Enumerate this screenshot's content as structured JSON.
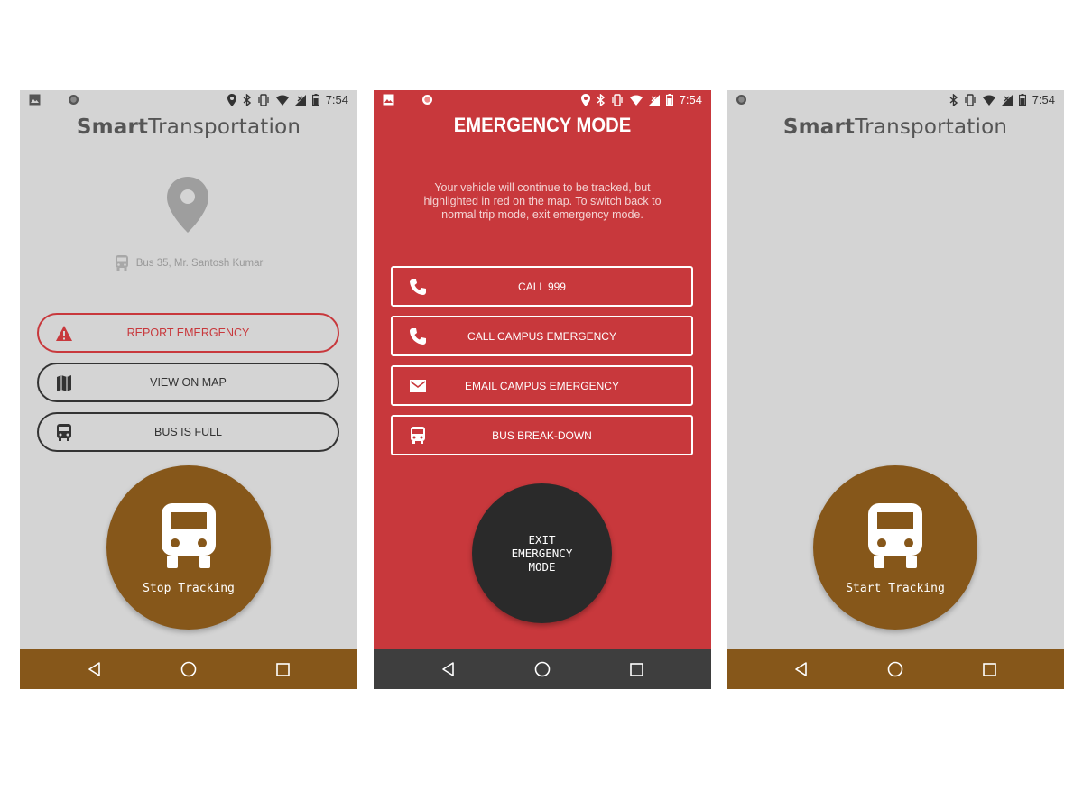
{
  "status_bar": {
    "time": "7:54"
  },
  "screen1": {
    "app_title_bold": "Smart",
    "app_title_rest": "Transportation",
    "bus_info": "Bus 35, Mr. Santosh Kumar",
    "buttons": [
      {
        "label": "REPORT EMERGENCY",
        "icon": "warning-icon"
      },
      {
        "label": "VIEW ON MAP",
        "icon": "map-icon"
      },
      {
        "label": "BUS IS FULL",
        "icon": "bus-icon"
      }
    ],
    "circle_label": "Stop Tracking"
  },
  "screen2": {
    "title": "EMERGENCY MODE",
    "description": "Your vehicle will continue to be tracked, but highlighted in red on the map. To switch back to normal trip mode, exit emergency mode.",
    "buttons": [
      {
        "label": "CALL 999",
        "icon": "phone-icon"
      },
      {
        "label": "CALL CAMPUS EMERGENCY",
        "icon": "phone-icon"
      },
      {
        "label": "EMAIL CAMPUS EMERGENCY",
        "icon": "email-icon"
      },
      {
        "label": "BUS BREAK-DOWN",
        "icon": "bus-icon"
      }
    ],
    "circle_label": "EXIT EMERGENCY MODE"
  },
  "screen3": {
    "app_title_bold": "Smart",
    "app_title_rest": "Transportation",
    "circle_label": "Start Tracking"
  },
  "colors": {
    "brown": "#86571a",
    "emergency_red": "#c8383c",
    "background_gray": "#d4d4d4",
    "dark_nav": "#3e3e3e"
  }
}
